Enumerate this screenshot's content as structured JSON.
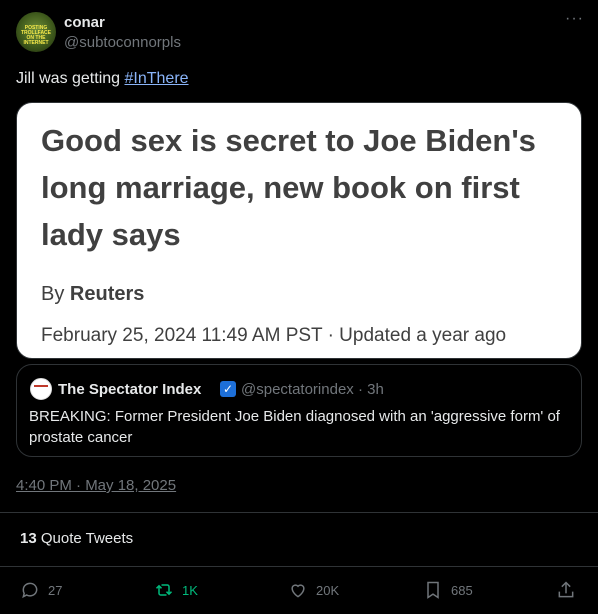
{
  "author": {
    "name": "conar",
    "handle": "@subtoconnorpls",
    "avatar_caption": "POSTING TROLLFACE ON THE INTERNET"
  },
  "tweet": {
    "text_prefix": "Jill was getting ",
    "hashtag": "#InThere",
    "timestamp": "4:40 PM · May 18, 2025"
  },
  "media_card": {
    "headline": "Good sex is secret to Joe Biden's long marriage, new book on first lady says",
    "byline_prefix": "By ",
    "byline_source": "Reuters",
    "dateline": "February 25, 2024 11:49 AM PST · Updated a year ago"
  },
  "quoted_tweet": {
    "name": "The Spectator Index",
    "handle_time": "@spectatorindex · 3h",
    "text": "BREAKING: Former President Joe Biden diagnosed with an 'aggressive form' of prostate cancer",
    "avatar_text": "INDEX"
  },
  "quote_tweets": {
    "count": "13",
    "label": " Quote Tweets"
  },
  "actions": {
    "replies": "27",
    "retweets": "1K",
    "likes": "20K",
    "bookmarks": "685"
  },
  "colors": {
    "background": "#000000",
    "hashtag": "#8ab4f8",
    "retweet_active": "#00ba7c",
    "muted": "#71767b",
    "verified": "#1d6fd8"
  },
  "more_icon": "ellipsis-icon"
}
